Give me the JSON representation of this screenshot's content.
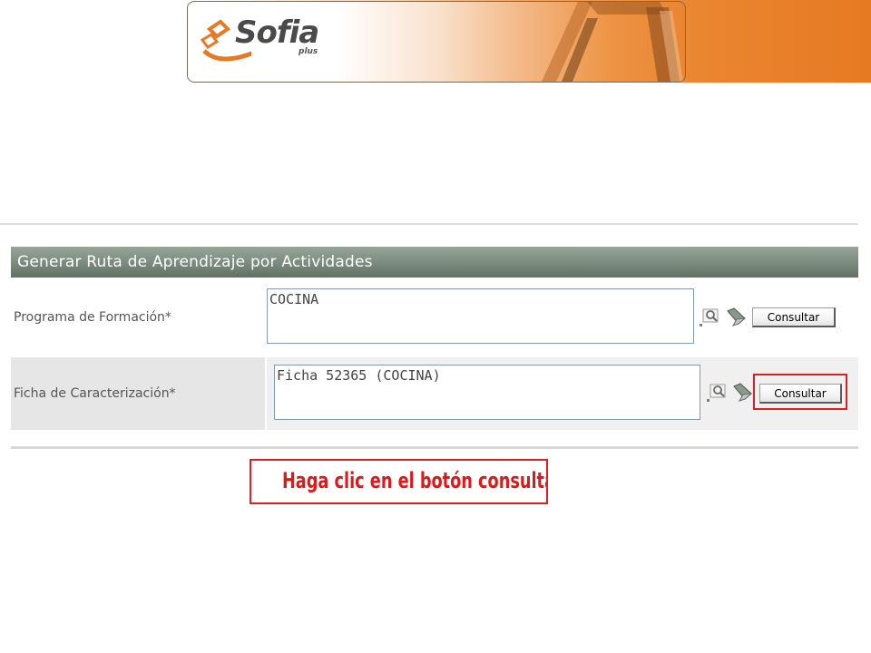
{
  "header": {
    "logo_text": "Sofia",
    "logo_subtext": "plus",
    "colors": {
      "accent": "#e67a22",
      "logo_orange": "#e67a22",
      "logo_gray": "#4a4a4a"
    }
  },
  "form": {
    "title": "Generar Ruta de Aprendizaje por Actividades",
    "colors": {
      "title_bar": "#7f8f81",
      "highlight": "#e02020"
    },
    "fields": [
      {
        "label": "Programa de Formación*",
        "value": "COCINA",
        "search_icon": "magnifier-icon",
        "clear_icon": "eraser-icon",
        "button_label": "Consultar"
      },
      {
        "label": "Ficha de Caracterización*",
        "value": "Ficha 52365 (COCINA)",
        "search_icon": "magnifier-icon",
        "clear_icon": "eraser-icon",
        "button_label": "Consultar"
      }
    ]
  },
  "callout": {
    "text": "Haga clic en el botón consultar"
  }
}
